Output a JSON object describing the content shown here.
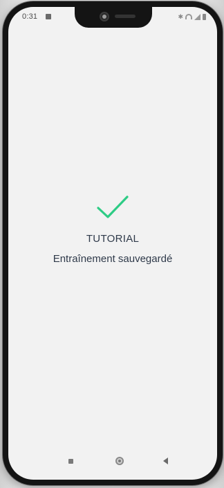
{
  "status_bar": {
    "time": "0:31",
    "notification_icon": "message-icon",
    "right_icons": [
      "bluetooth-icon",
      "wifi-icon",
      "signal-icon",
      "battery-icon"
    ]
  },
  "confirmation": {
    "icon": "checkmark-icon",
    "icon_color": "#2ecc85",
    "title": "TUTORIAL",
    "message": "Entraînement sauvegardé"
  },
  "nav_bar": {
    "buttons": [
      "recent-apps-icon",
      "home-icon",
      "back-icon"
    ]
  }
}
